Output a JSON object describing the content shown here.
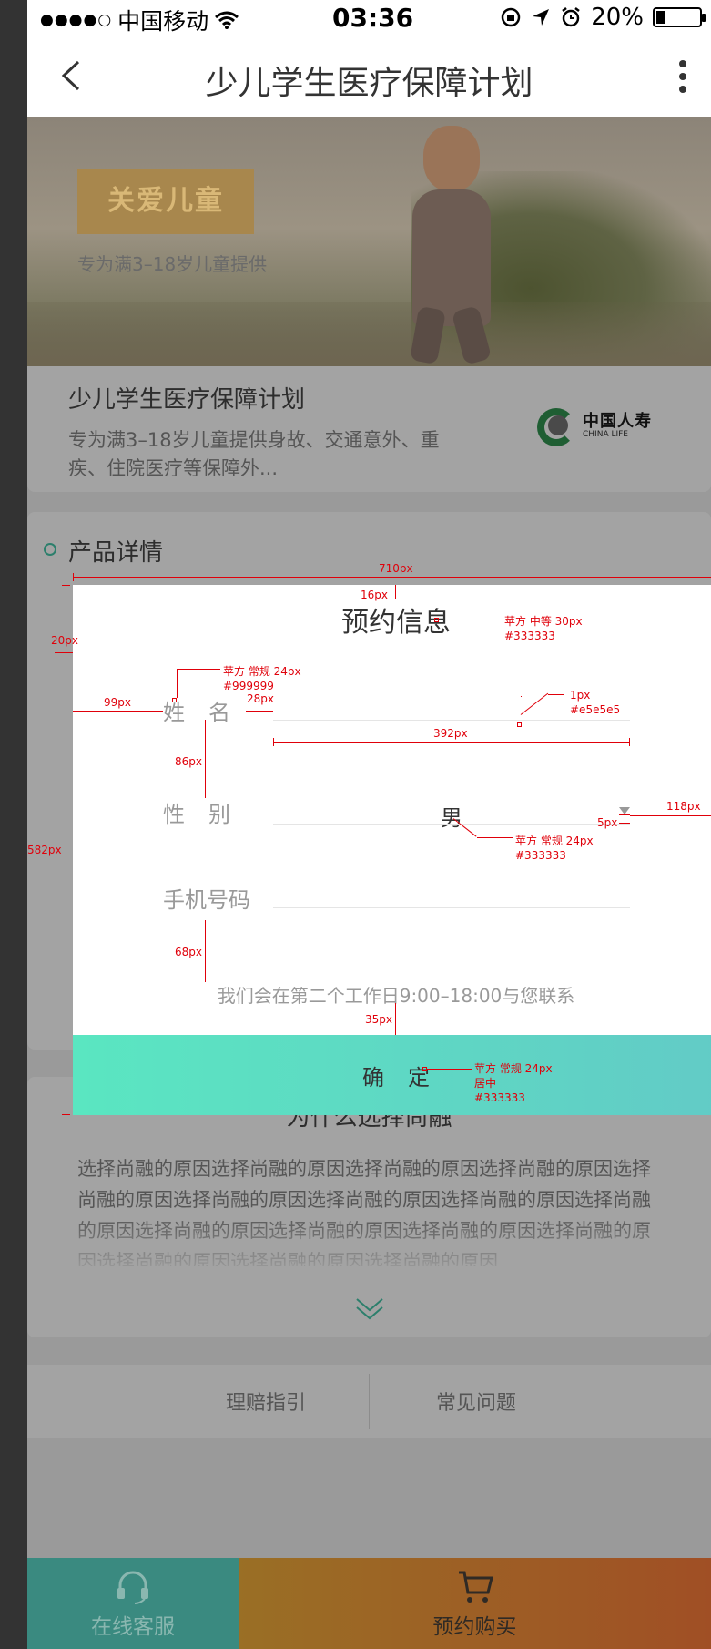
{
  "status_bar": {
    "signal_dots": "●●●●○",
    "carrier": "中国移动",
    "time": "03:36",
    "battery_percent": "20%",
    "battery_level": 0.2
  },
  "nav": {
    "title": "少儿学生医疗保障计划",
    "back_icon": "chevron-left-icon",
    "more_icon": "more-vertical-icon"
  },
  "banner": {
    "badge": "关爱儿童",
    "subtitle": "专为满3–18岁儿童提供"
  },
  "product_card": {
    "title": "少儿学生医疗保障计划",
    "description": "专为满3–18岁儿童提供身故、交通意外、重疾、住院医疗等保障外...",
    "logo_cn": "中国人寿",
    "logo_en": "CHINA LIFE"
  },
  "product_section": {
    "title": "产品详情"
  },
  "modal": {
    "title": "预约信息",
    "name_label": "姓名",
    "gender_label": "性别",
    "gender_value": "男",
    "phone_label": "手机号码",
    "note": "我们会在第二个工作日9:00–18:00与您联系",
    "confirm_label": "确定"
  },
  "why_section": {
    "title": "为什么选择尚融",
    "body": "选择尚融的原因选择尚融的原因选择尚融的原因选择尚融的原因选择尚融的原因选择尚融的原因选择尚融的原因选择尚融的原因选择尚融的原因选择尚融的原因选择尚融的原因选择尚融的原因选择尚融的原因选择尚融的原因选择尚融的原因选择尚融的原因"
  },
  "links": {
    "claims_guide": "理赔指引",
    "faq": "常见问题"
  },
  "bottom_bar": {
    "service_label": "在线客服",
    "buy_label": "预约购买"
  },
  "annotations": {
    "width_710": "710px",
    "gap_16": "16px",
    "title_font": "苹方 中等 30px",
    "title_color": "#333333",
    "margin_20": "20px",
    "label_font": "苹方 常规 24px",
    "label_color": "#999999",
    "gap_28": "28px",
    "left_99": "99px",
    "line_thickness": "1px",
    "line_color": "#e5e5e5",
    "line_width_392": "392px",
    "row_86": "86px",
    "right_118": "118px",
    "caret_5": "5px",
    "value_font": "苹方 常规 24px",
    "value_color": "#333333",
    "height_582": "582px",
    "gap_68": "68px",
    "gap_35": "35px",
    "button_font": "苹方 常规 24px",
    "button_align": "居中",
    "button_color": "#333333"
  },
  "colors": {
    "modal_bg": "#ffffff",
    "button_gradient_start": "#5ae6c1",
    "button_gradient_end": "#62cbc6",
    "annotation": "#e0000a",
    "divider": "#e5e5e5",
    "label": "#999999",
    "text": "#333333"
  }
}
